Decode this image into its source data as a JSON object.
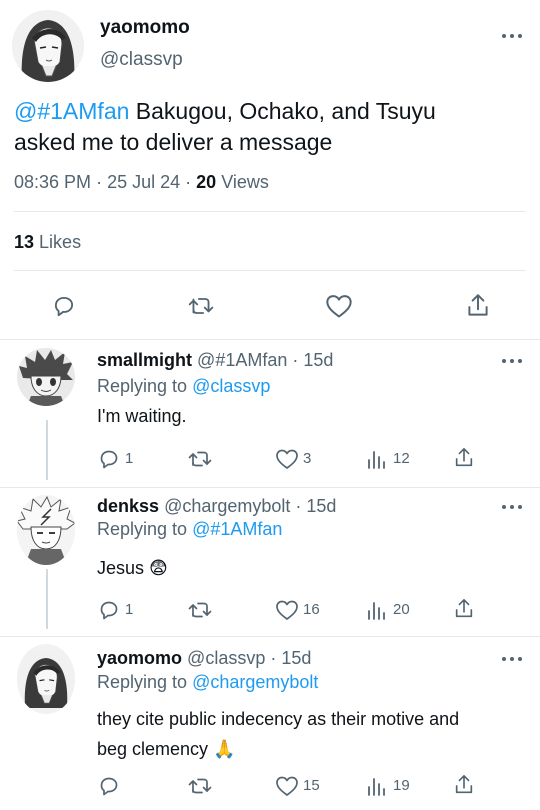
{
  "main_tweet": {
    "display_name": "yaomomo",
    "handle": "@classvp",
    "mention": "@#1AMfan",
    "text_line1": " Bakugou, Ochako, and Tsuyu",
    "text_line2": "asked me to deliver a message",
    "time": "08:36 PM",
    "sep1": "·",
    "date": "25 Jul 24",
    "sep2": "·",
    "views_count": "20",
    "views_label": "Views",
    "likes_count": "13",
    "likes_label": "Likes"
  },
  "replies": [
    {
      "display_name": "smallmight",
      "meta": "@#1AMfan · 15d",
      "replying_prefix": "Replying to ",
      "replying_to": "@classvp",
      "text": "I'm waiting.",
      "replies": "1",
      "retweets": "",
      "likes": "3",
      "views": "12"
    },
    {
      "display_name": "denkss",
      "meta": "@chargemybolt · 15d",
      "replying_prefix": "Replying to ",
      "replying_to": "@#1AMfan",
      "text": "Jesus 😨",
      "replies": "1",
      "retweets": "",
      "likes": "16",
      "views": "20"
    },
    {
      "display_name": "yaomomo",
      "meta": "@classvp · 15d",
      "replying_prefix": "Replying to ",
      "replying_to": "@chargemybolt",
      "text_line1": "they cite public indecency as their motive and",
      "text_line2": "beg clemency 🙏",
      "replies": "",
      "retweets": "",
      "likes": "15",
      "views": "19"
    }
  ],
  "colors": {
    "accent": "#1d9bf0",
    "muted": "#536471",
    "divider": "#e6e9ec"
  },
  "icons": [
    "more-icon",
    "reply-icon",
    "retweet-icon",
    "like-icon",
    "share-icon",
    "views-icon"
  ]
}
